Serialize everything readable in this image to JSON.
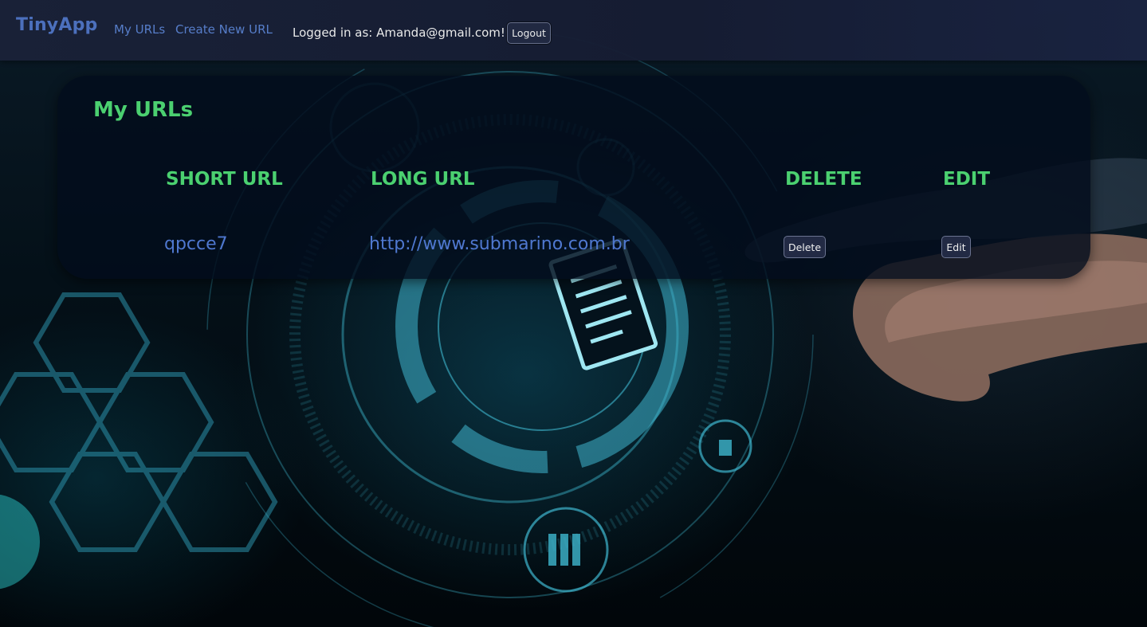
{
  "navbar": {
    "brand": "TinyApp",
    "links": [
      "My URLs",
      "Create New URL"
    ],
    "logged_in_text": "Logged in as: Amanda@gmail.com!",
    "logout_label": "Logout"
  },
  "main": {
    "title": "My URLs",
    "table": {
      "headers": [
        "SHORT URL",
        "LONG URL",
        "DELETE",
        "EDIT"
      ],
      "rows": [
        {
          "short_url": "qpcce7",
          "long_url": "http://www.submarino.com.br",
          "delete_label": "Delete",
          "edit_label": "Edit"
        }
      ]
    }
  },
  "colors": {
    "accent_green": "#4bd070",
    "link_blue": "#4f78d0",
    "navbar_bg": "#1a2238"
  }
}
